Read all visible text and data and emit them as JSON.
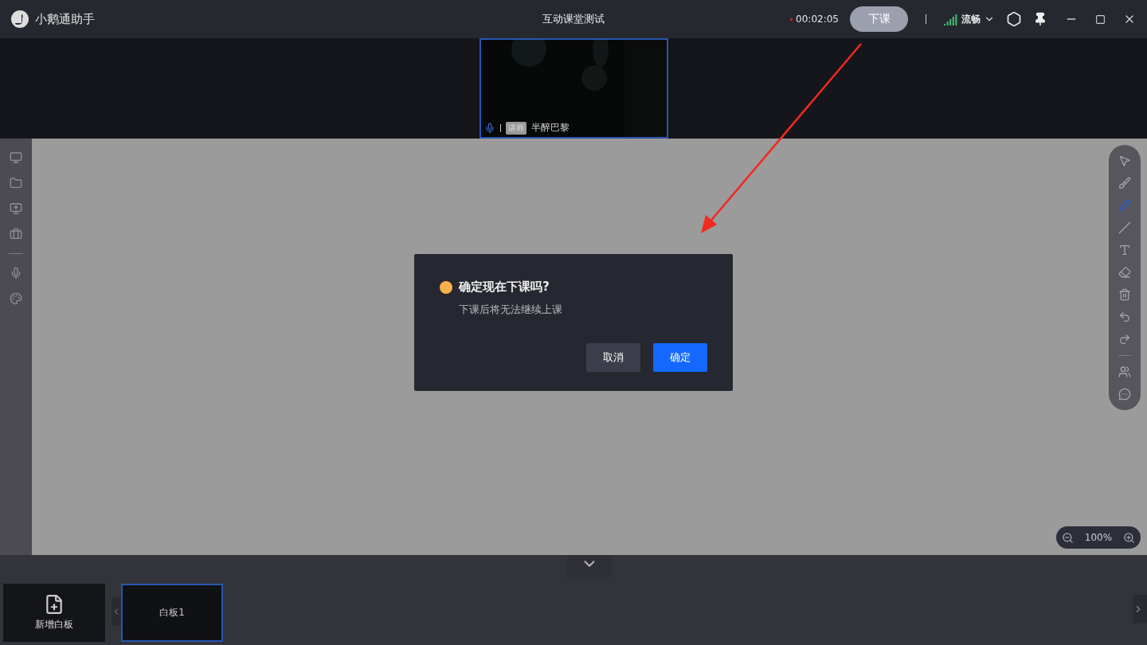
{
  "app": {
    "name": "小鹅通助手"
  },
  "window": {
    "title": "互动课堂测试"
  },
  "status": {
    "recording": true,
    "timer": "00:02:05",
    "end_button": "下课",
    "network_label": "流畅"
  },
  "video": {
    "role_badge": "讲师",
    "name": "半醉巴黎",
    "mic_on": true
  },
  "left_tools": [
    {
      "kind": "screen"
    },
    {
      "kind": "folder"
    },
    {
      "kind": "share"
    },
    {
      "kind": "toolbox"
    },
    {
      "kind": "divider"
    },
    {
      "kind": "mic"
    },
    {
      "kind": "palette"
    }
  ],
  "board_tools": [
    {
      "kind": "select",
      "selected": false
    },
    {
      "kind": "brush",
      "selected": false
    },
    {
      "kind": "pen",
      "selected": true
    },
    {
      "kind": "line",
      "selected": false
    },
    {
      "kind": "text",
      "selected": false
    },
    {
      "kind": "eraser",
      "selected": false
    },
    {
      "kind": "delete",
      "selected": false
    },
    {
      "kind": "undo",
      "selected": false
    },
    {
      "kind": "redo",
      "selected": false
    },
    {
      "kind": "divider"
    },
    {
      "kind": "members",
      "selected": false
    },
    {
      "kind": "chat",
      "selected": false
    }
  ],
  "zoom": {
    "value": "100%"
  },
  "dialog": {
    "title": "确定现在下课吗?",
    "message": "下课后将无法继续上课",
    "buttons": [
      {
        "label": "取消",
        "kind": "secondary"
      },
      {
        "label": "确定",
        "kind": "primary"
      }
    ]
  },
  "slides": {
    "add_label": "新增白板",
    "items": [
      {
        "label": "白板1",
        "selected": true
      }
    ]
  }
}
